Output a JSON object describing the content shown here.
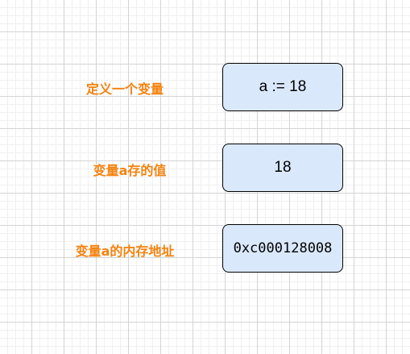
{
  "colors": {
    "label_text": "#f5820f",
    "box_fill": "#dae8fc",
    "box_border": "#000000"
  },
  "rows": [
    {
      "label": "定义一个变量",
      "value": "a := 18"
    },
    {
      "label": "变量a存的值",
      "value": "18"
    },
    {
      "label": "变量a的内存地址",
      "value": "0xc000128008"
    }
  ]
}
